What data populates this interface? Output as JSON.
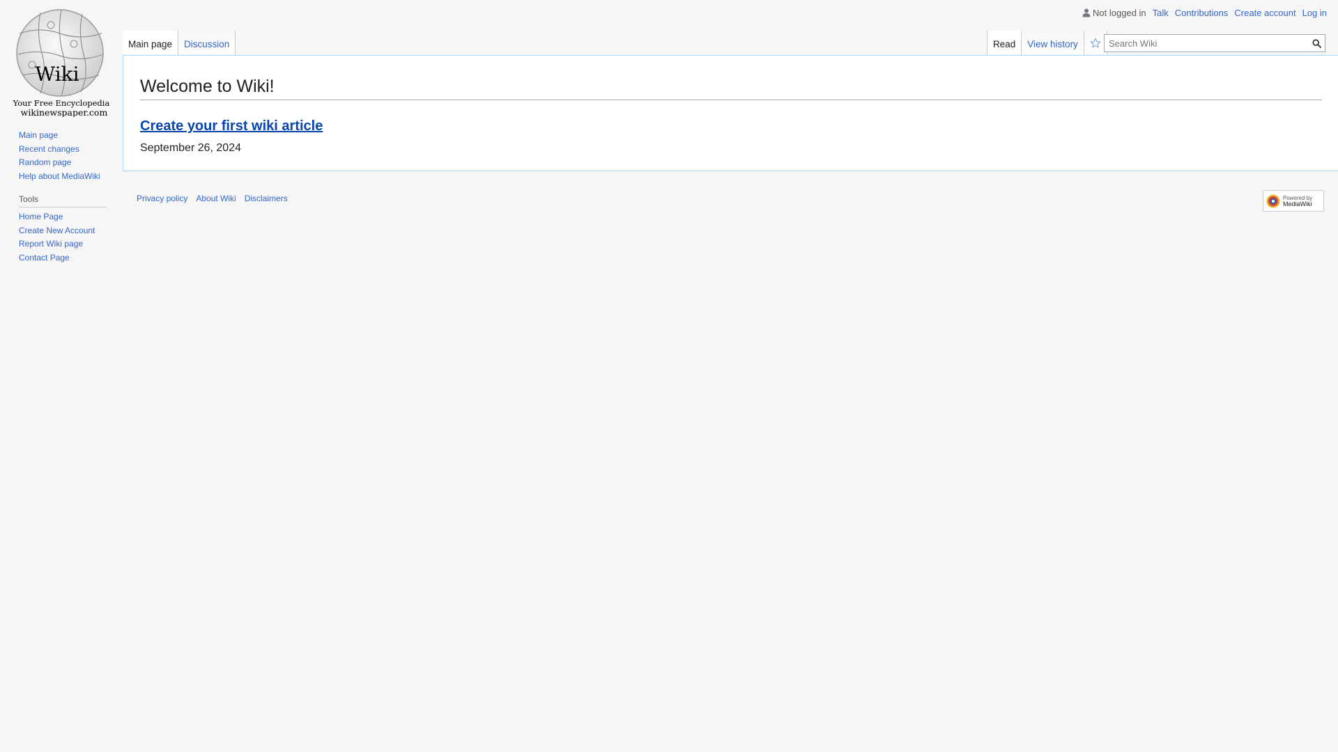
{
  "logo": {
    "wordmark": "Wiki",
    "tagline": "Your Free Encyclopedia",
    "domain": "wikinewspaper.com"
  },
  "personal_tools": {
    "status": "Not logged in",
    "links": [
      "Talk",
      "Contributions",
      "Create account",
      "Log in"
    ]
  },
  "tabs": {
    "left": [
      {
        "label": "Main page",
        "selected": true
      },
      {
        "label": "Discussion",
        "selected": false
      }
    ],
    "right": [
      {
        "label": "Read",
        "selected": true
      },
      {
        "label": "View history",
        "selected": false
      }
    ]
  },
  "search": {
    "placeholder": "Search Wiki",
    "value": ""
  },
  "content": {
    "title": "Welcome to Wiki!",
    "article_link": "Create your first wiki article",
    "date": "September 26, 2024"
  },
  "sidebar": {
    "navigation": [
      "Main page",
      "Recent changes",
      "Random page",
      "Help about MediaWiki"
    ],
    "tools_heading": "Tools",
    "tools": [
      "Home Page",
      "Create New Account",
      "Report Wiki page",
      "Contact Page"
    ]
  },
  "footer": {
    "links": [
      "Privacy policy",
      "About Wiki",
      "Disclaimers"
    ],
    "powered_by_small": "Powered by",
    "powered_by_big": "MediaWiki"
  },
  "colors": {
    "link": "#3366cc",
    "visited_link": "#0645ad",
    "border": "#a7d7f9",
    "background": "#f6f6f6"
  }
}
